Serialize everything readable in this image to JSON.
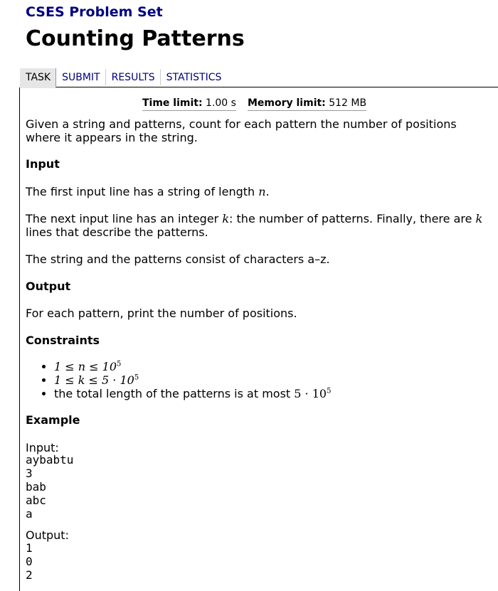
{
  "site": {
    "title": "CSES Problem Set"
  },
  "task": {
    "title": "Counting Patterns"
  },
  "nav": {
    "tabs": [
      {
        "label": "TASK"
      },
      {
        "label": "SUBMIT"
      },
      {
        "label": "RESULTS"
      },
      {
        "label": "STATISTICS"
      }
    ]
  },
  "limits": {
    "time_label": "Time limit:",
    "time_value": "1.00 s",
    "memory_label": "Memory limit:",
    "memory_value": "512 MB"
  },
  "statement": {
    "intro": "Given a string and patterns, count for each pattern the number of positions where it appears in the string.",
    "input_heading": "Input",
    "input_p1_pre": "The first input line has a string of length ",
    "input_p1_var": "n",
    "input_p1_post": ".",
    "input_p2_pre": "The next input line has an integer ",
    "input_p2_var": "k",
    "input_p2_mid": ": the number of patterns. Finally, there are ",
    "input_p2_var2": "k",
    "input_p2_post": " lines that describe the patterns.",
    "input_p3": "The string and the patterns consist of characters a–z.",
    "output_heading": "Output",
    "output_p": "For each pattern, print the number of positions.",
    "constraints_heading": "Constraints",
    "constraint_1": "1 ≤ n ≤ 10",
    "constraint_1_exp": "5",
    "constraint_2": "1 ≤ k ≤ 5 · 10",
    "constraint_2_exp": "5",
    "constraint_3_text": "the total length of the patterns is at most ",
    "constraint_3_math": "5 · 10",
    "constraint_3_exp": "5",
    "example_heading": "Example",
    "example_input_label": "Input:",
    "example_input": "aybabtu\n3\nbab\nabc\na",
    "example_output_label": "Output:",
    "example_output": "1\n0\n2"
  }
}
